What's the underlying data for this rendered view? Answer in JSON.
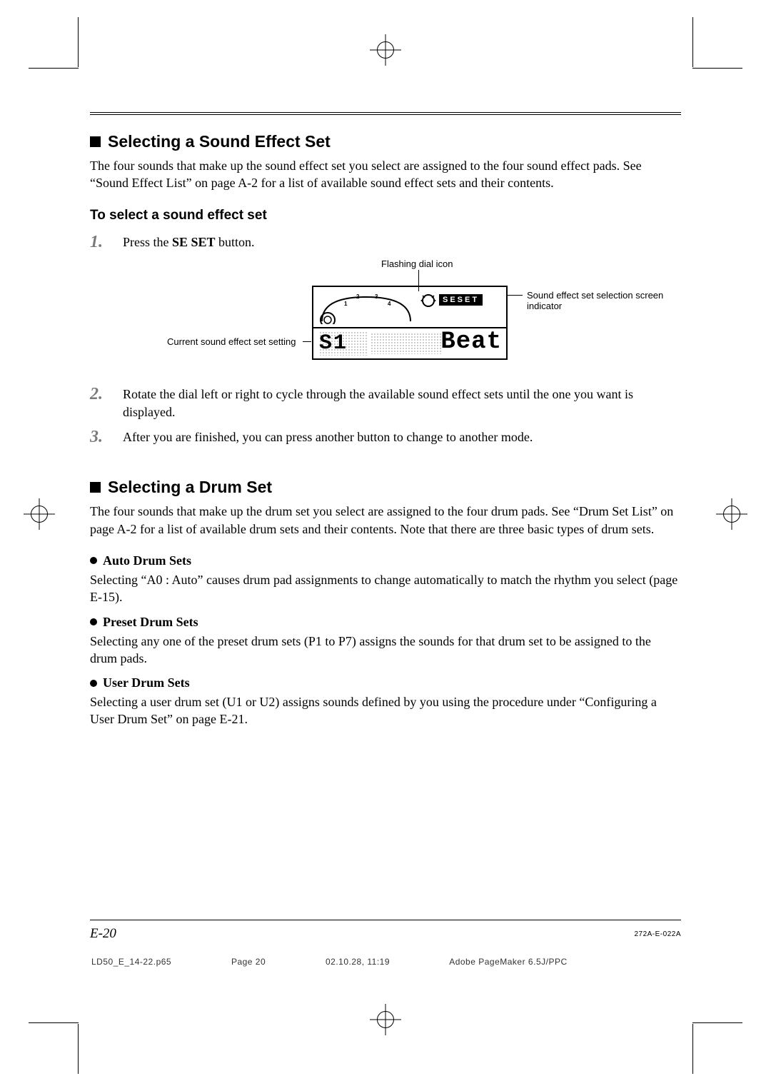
{
  "section1": {
    "heading": "Selecting a Sound Effect Set",
    "intro": "The four sounds that make up the sound effect set you select are assigned to the four sound effect pads. See “Sound Effect List” on page A-2 for a list of available sound effect sets and their contents.",
    "sub": "To select a sound effect set",
    "steps": {
      "s1_pre": "Press the ",
      "s1_bold": "SE SET",
      "s1_post": " button.",
      "s2": "Rotate the dial left or right to cycle through the available sound effect sets until the one you want is displayed.",
      "s3": "After you are finished, you can press another button to change to another mode."
    }
  },
  "diagram": {
    "label_top": "Flashing dial icon",
    "label_right": "Sound effect set selection screen indicator",
    "label_left": "Current sound effect set setting",
    "lcd_indicator": "SESET",
    "lcd_num": "S1",
    "lcd_name": "Beat",
    "pad_nums": {
      "n1": "1",
      "n2": "2",
      "n3": "3",
      "n4": "4"
    }
  },
  "section2": {
    "heading": "Selecting a Drum Set",
    "intro": "The four sounds that make up the drum set you select are assigned to the four drum pads. See “Drum Set List” on page A-2 for a list of available drum sets and their contents. Note that there are three basic types of drum sets.",
    "b1_h": "Auto Drum Sets",
    "b1_p": "Selecting “A0 : Auto” causes drum pad assignments to change automatically to match the rhythm you select (page E-15).",
    "b2_h": "Preset Drum Sets",
    "b2_p": "Selecting any one of the preset drum sets (P1 to P7) assigns the sounds for that drum set to be assigned to the drum pads.",
    "b3_h": "User Drum Sets",
    "b3_p": "Selecting a user drum set (U1 or U2) assigns sounds defined by you using the procedure under “Configuring a User Drum Set” on page E-21."
  },
  "footer": {
    "page_display": "E-20",
    "doc_code": "272A-E-022A"
  },
  "slug": {
    "file": "LD50_E_14-22.p65",
    "page": "Page 20",
    "date": "02.10.28, 11:19",
    "app": "Adobe PageMaker 6.5J/PPC"
  },
  "nums": {
    "one": "1",
    "two": "2",
    "three": "3"
  }
}
